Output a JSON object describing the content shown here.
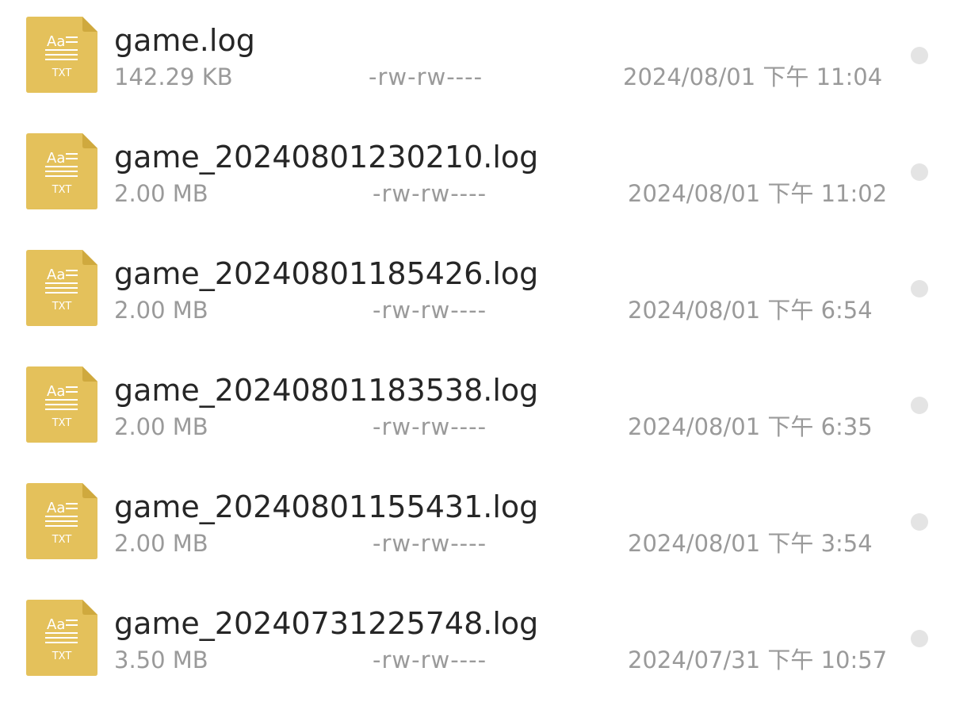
{
  "colors": {
    "icon_fill": "#e4c15b",
    "icon_fold": "#cfa93e",
    "name_text": "#262626",
    "meta_text": "#9a9a9a",
    "dot": "#e4e4e4"
  },
  "icon": {
    "name": "txt-file-icon",
    "top_label": "Aa",
    "bottom_label": "TXT"
  },
  "files": [
    {
      "name": "game.log",
      "size": "142.29 KB",
      "permissions": "-rw-rw----",
      "modified": "2024/08/01 下午 11:04"
    },
    {
      "name": "game_20240801230210.log",
      "size": "2.00 MB",
      "permissions": "-rw-rw----",
      "modified": "2024/08/01 下午 11:02"
    },
    {
      "name": "game_20240801185426.log",
      "size": "2.00 MB",
      "permissions": "-rw-rw----",
      "modified": "2024/08/01 下午 6:54"
    },
    {
      "name": "game_20240801183538.log",
      "size": "2.00 MB",
      "permissions": "-rw-rw----",
      "modified": "2024/08/01 下午 6:35"
    },
    {
      "name": "game_20240801155431.log",
      "size": "2.00 MB",
      "permissions": "-rw-rw----",
      "modified": "2024/08/01 下午 3:54"
    },
    {
      "name": "game_20240731225748.log",
      "size": "3.50 MB",
      "permissions": "-rw-rw----",
      "modified": "2024/07/31 下午 10:57"
    }
  ]
}
